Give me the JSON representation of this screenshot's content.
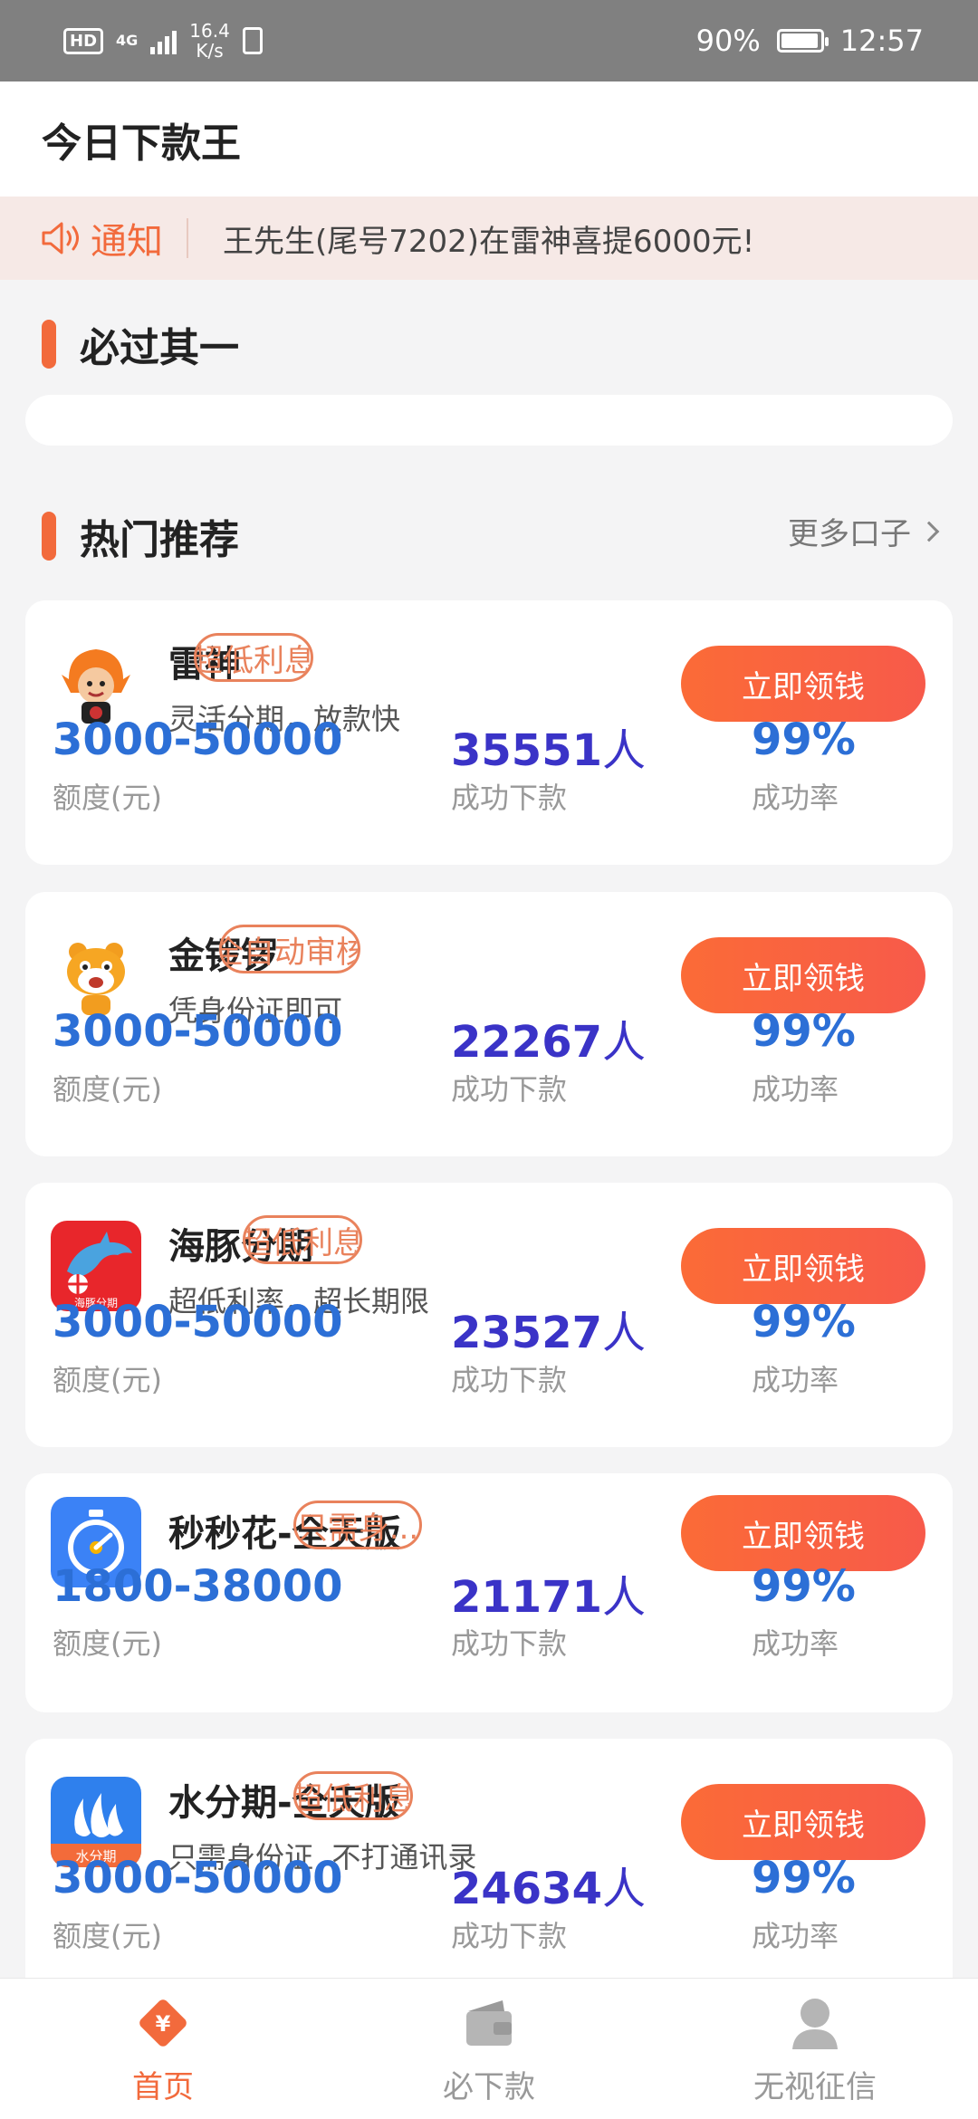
{
  "status_bar": {
    "hd": "HD",
    "network": "4G",
    "speed_value": "16.4",
    "speed_unit": "K/s",
    "battery": "90%",
    "time": "12:57"
  },
  "header": {
    "title": "今日下款王"
  },
  "notice": {
    "label": "通知",
    "text": "王先生(尾号7202)在雷神喜提6000元!",
    "icon": "speaker-icon"
  },
  "section_must_pass": {
    "title": "必过其一"
  },
  "section_hot": {
    "title": "热门推荐",
    "more_label": "更多口子"
  },
  "labels": {
    "amount": "额度(元)",
    "count": "成功下款",
    "rate": "成功率",
    "cta": "立即领钱",
    "person_unit": "人"
  },
  "products": [
    {
      "name": "雷神",
      "tag": "超低利息",
      "desc": "灵活分期，放款快",
      "amount": "3000-50000",
      "count": "35551",
      "rate": "99%",
      "icon": "thunder-god-logo"
    },
    {
      "name": "金锣锣",
      "tag": "全自动审核",
      "desc": "凭身份证即可",
      "amount": "3000-50000",
      "count": "22267",
      "rate": "99%",
      "icon": "tiger-mascot-logo"
    },
    {
      "name": "海豚分期",
      "tag": "超低利息",
      "desc": "超低利率，超长期限",
      "amount": "3000-50000",
      "count": "23527",
      "rate": "99%",
      "icon": "dolphin-logo",
      "logo_text": "海豚分期"
    },
    {
      "name": "秒秒花-全天版",
      "tag": "只需身...",
      "desc": "",
      "amount": "1800-38000",
      "count": "21171",
      "rate": "99%",
      "icon": "stopwatch-logo"
    },
    {
      "name": "水分期-全天版",
      "tag": "超低利息",
      "desc": "只需身份证  不打通讯录",
      "amount": "3000-50000",
      "count": "24634",
      "rate": "99%",
      "icon": "water-drop-logo",
      "logo_text": "水分期"
    }
  ],
  "bottom_nav": [
    {
      "label": "首页",
      "icon": "home-money-icon",
      "active": true
    },
    {
      "label": "必下款",
      "icon": "wallet-icon",
      "active": false
    },
    {
      "label": "无视征信",
      "icon": "user-icon",
      "active": false
    }
  ],
  "colors": {
    "accent": "#f26a3c",
    "cta_gradient_start": "#fb6b37",
    "cta_gradient_end": "#f75a4a",
    "amount_blue": "#2c6fd6",
    "count_indigo": "#3a33c7",
    "notice_bg": "#f6e9e6"
  }
}
